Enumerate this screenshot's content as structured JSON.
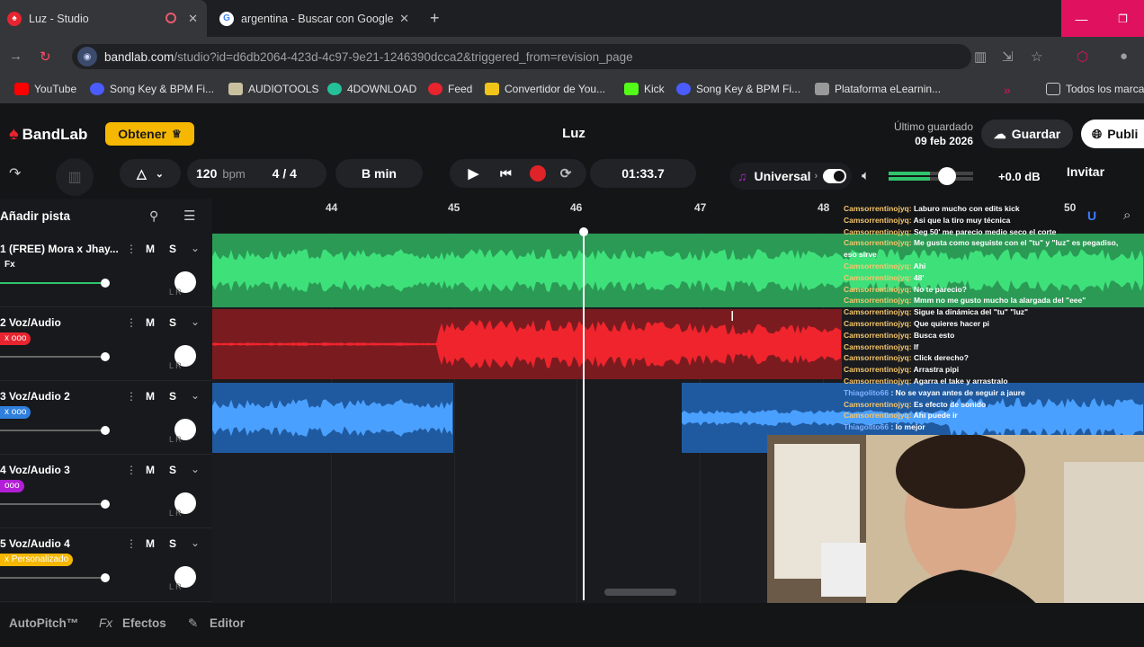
{
  "browser": {
    "tabs": [
      {
        "title": "Luz - Studio",
        "active": true
      },
      {
        "title": "argentina - Buscar con Google",
        "active": false
      }
    ],
    "url_host": "bandlab.com",
    "url_path": "/studio?id=d6db2064-423d-4c97-9e21-1246390dcca2&triggered_from=revision_page",
    "bookmarks": [
      "YouTube",
      "Song Key & BPM Fi...",
      "AUDIOTOOLS",
      "4DOWNLOAD",
      "Feed",
      "Convertidor de You...",
      "Kick",
      "Song Key & BPM Fi...",
      "Plataforma eLearnin...",
      "Todos los marca"
    ],
    "overflow_label": "»"
  },
  "header": {
    "brand": "BandLab",
    "get_button": "Obtener",
    "title": "Luz",
    "last_saved_label": "Último guardado",
    "last_saved_date": "09 feb 2026",
    "save_button": "Guardar",
    "publish_button": "Publi"
  },
  "transport": {
    "tempo": "120",
    "tempo_unit": "bpm",
    "time_signature": "4 / 4",
    "key": "B min",
    "time": "01:33.7",
    "instrument": "Universal",
    "master_gain": "+0.0 dB",
    "invite": "Invitar"
  },
  "tracks_panel": {
    "add_track": "Añadir pista",
    "tracks": [
      {
        "num": "1",
        "name": "(FREE) Mora x Jhay...",
        "fx": "Fx",
        "fx_color": "",
        "mute": "M",
        "solo": "S",
        "color": "#2fc46b",
        "volume": 0.97
      },
      {
        "num": "2",
        "name": "Voz/Audio",
        "fx": "x ooo",
        "fx_color": "#e8242f",
        "mute": "M",
        "solo": "S",
        "color": "#e02328",
        "volume": 0.97
      },
      {
        "num": "3",
        "name": "Voz/Audio 2",
        "fx": "x ooo",
        "fx_color": "#2f7fdc",
        "mute": "M",
        "solo": "S",
        "color": "#2f7fdc",
        "volume": 0.97
      },
      {
        "num": "4",
        "name": "Voz/Audio 3",
        "fx": "ooo",
        "fx_color": "#b21ed6",
        "mute": "M",
        "solo": "S",
        "color": "#b21ed6",
        "volume": 0.97
      },
      {
        "num": "5",
        "name": "Voz/Audio 4",
        "fx": "x Personalizado",
        "fx_color": "#f5b700",
        "mute": "M",
        "solo": "S",
        "color": "#f5b700",
        "volume": 0.97
      }
    ],
    "knob_labels": "L R"
  },
  "ruler": {
    "ticks": [
      "44",
      "45",
      "46",
      "47",
      "48",
      "50"
    ]
  },
  "chat": [
    {
      "user": "Camsorrentinojyq:",
      "msg": "Laburo mucho con edits kick",
      "alt": false
    },
    {
      "user": "Camsorrentinojyq:",
      "msg": "Asi que la tiro muy técnica",
      "alt": false
    },
    {
      "user": "Camsorrentinojyq:",
      "msg": "Seg 50' me parecio medio seco el corte",
      "alt": false
    },
    {
      "user": "Camsorrentinojyq:",
      "msg": "Me gusta como seguiste con el \"tu\" y \"luz\" es pegadiso,",
      "alt": false
    },
    {
      "user": "",
      "msg": "eso sirve",
      "alt": false
    },
    {
      "user": "Camsorrentinojyq:",
      "msg": "Ahi",
      "alt": false
    },
    {
      "user": "Camsorrentinojyq:",
      "msg": "48'",
      "alt": false
    },
    {
      "user": "Camsorrentinojyq:",
      "msg": "No te parecio?",
      "alt": false
    },
    {
      "user": "Camsorrentinojyq:",
      "msg": "Mmm no me gusto mucho la alargada del \"eee\"",
      "alt": false
    },
    {
      "user": "Camsorrentinojyq:",
      "msg": "Sigue la dinámica del \"tu\" \"luz\"",
      "alt": false
    },
    {
      "user": "Camsorrentinojyq:",
      "msg": "Que quieres hacer pi",
      "alt": false
    },
    {
      "user": "Camsorrentinojyq:",
      "msg": "Busca esto",
      "alt": false
    },
    {
      "user": "Camsorrentinojyq:",
      "msg": "If",
      "alt": false
    },
    {
      "user": "Camsorrentinojyq:",
      "msg": "Click derecho?",
      "alt": false
    },
    {
      "user": "Camsorrentinojyq:",
      "msg": "Arrastra pipi",
      "alt": false
    },
    {
      "user": "Camsorrentinojyq:",
      "msg": "Agarra el take y arrastralo",
      "alt": false
    },
    {
      "user": "Thiagolito66",
      "msg": ": No se vayan antes de seguir a jaure",
      "alt": true
    },
    {
      "user": "Camsorrentinojyq:",
      "msg": "Es efecto de sonido",
      "alt": false
    },
    {
      "user": "Camsorrentinojyq:",
      "msg": "Ahi puede ir",
      "alt": false
    },
    {
      "user": "Thiagolito66",
      "msg": ": lo mejor",
      "alt": true
    }
  ],
  "bottom": {
    "autopitch": "AutoPitch™",
    "effects_prefix": "Fx",
    "effects": "Efectos",
    "editor": "Editor"
  },
  "colors": {
    "accent": "#f5b700",
    "record": "#e02328",
    "brand": "#e8242f"
  }
}
